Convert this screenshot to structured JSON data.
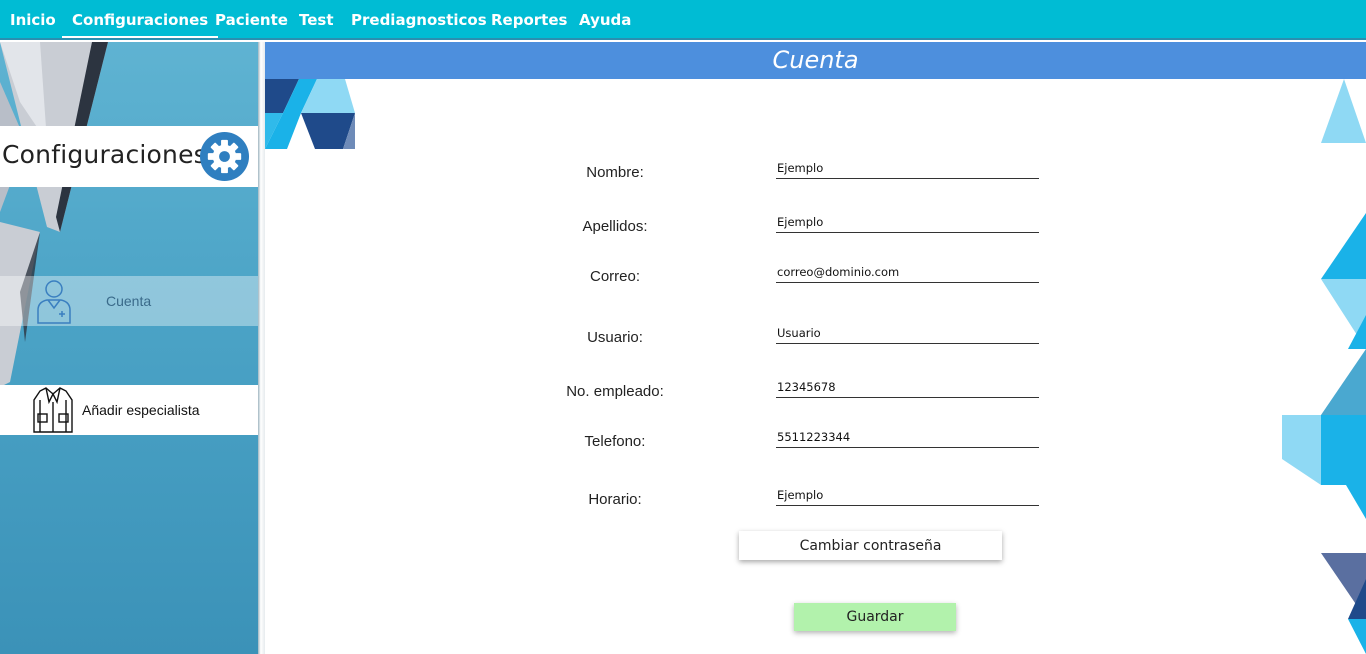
{
  "menu": {
    "items": [
      {
        "label": "Inicio"
      },
      {
        "label": "Configuraciones"
      },
      {
        "label": "Paciente"
      },
      {
        "label": "Test"
      },
      {
        "label": "Prediagnosticos"
      },
      {
        "label": "Reportes"
      },
      {
        "label": "Ayuda"
      }
    ],
    "active_item": "Configuraciones"
  },
  "sidebar": {
    "title": "Configuraciones",
    "title_icon": "gear-icon",
    "items": [
      {
        "label": "Cuenta",
        "icon": "doctor-icon",
        "selected": true
      },
      {
        "label": "Añadir especialista",
        "icon": "lab-coat-icon",
        "selected": false
      }
    ]
  },
  "main": {
    "title": "Cuenta",
    "fields": [
      {
        "label": "Nombre:",
        "value": "Ejemplo"
      },
      {
        "label": "Apellidos:",
        "value": "Ejemplo"
      },
      {
        "label": "Correo:",
        "value": "correo@dominio.com"
      },
      {
        "label": "Usuario:",
        "value": "Usuario"
      },
      {
        "label": "No. empleado:",
        "value": "12345678"
      },
      {
        "label": "Telefono:",
        "value": "5511223344"
      },
      {
        "label": "Horario:",
        "value": "Ejemplo"
      }
    ],
    "change_password_label": "Cambiar contraseña",
    "save_label": "Guardar"
  },
  "colors": {
    "topbar": "#00bcd4",
    "header": "#4d8fdd",
    "save_button": "#b2f2ac",
    "sidebar": "#4ba3c6"
  }
}
